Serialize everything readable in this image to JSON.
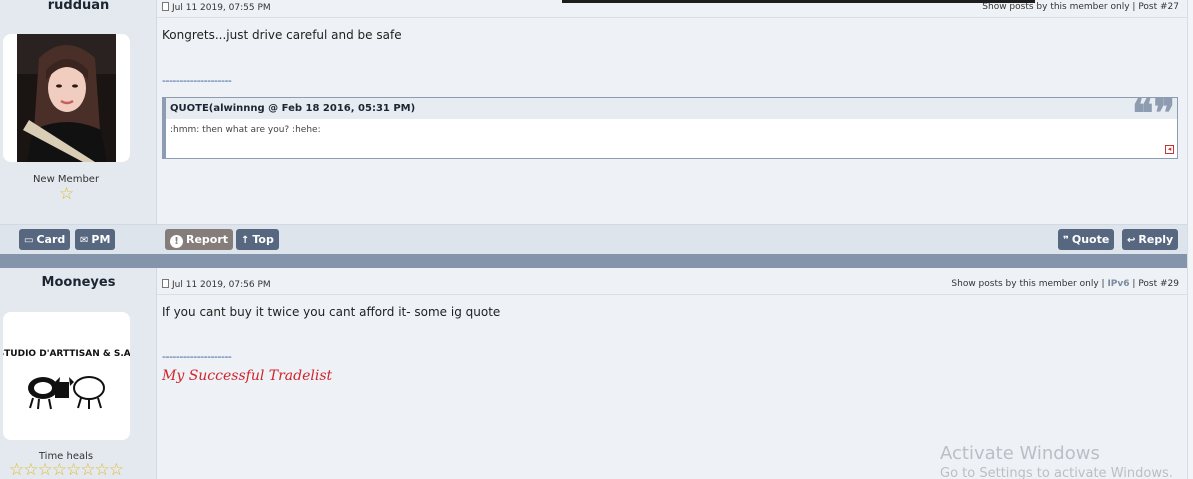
{
  "posts": [
    {
      "username": "rudduan",
      "rank": "New Member",
      "stars": "☆",
      "date": "Jul 11 2019, 07:55 PM",
      "show_posts": "Show posts by this member only",
      "sep": "|",
      "post_no": "Post #27",
      "body": "Kongrets...just drive careful and be safe",
      "sig_line": "--------------------",
      "quote_title": "QUOTE(alwinnng @ Feb 18 2016, 05:31 PM)",
      "quote_text": ":hmm: then what are you? :hehe:",
      "buttons": {
        "card": "Card",
        "pm": "PM",
        "report": "Report",
        "top": "Top",
        "quote": "Quote",
        "reply": "Reply"
      }
    },
    {
      "username": "Mooneyes",
      "rank": "Time heals",
      "stars": "☆☆☆☆☆☆☆☆",
      "date": "Jul 11 2019, 07:56 PM",
      "show_posts": "Show posts by this member only",
      "sep": "|",
      "ipv6": "IPv6",
      "post_no": "Post #29",
      "body": "If you cant buy it twice you cant afford it- some ig quote",
      "sig_line": "--------------------",
      "sig_link": "My Successful Tradelist",
      "avatar_logo": "STUDIO D'ARTTISAN & S.A."
    }
  ],
  "watermark": {
    "line1": "Activate Windows",
    "line2": "Go to Settings to activate Windows."
  },
  "colors": {
    "button": "#56677f",
    "report": "#857d7a",
    "divider": "#8494ab",
    "sig_link": "#d0242a",
    "star": "#e3b82b"
  }
}
